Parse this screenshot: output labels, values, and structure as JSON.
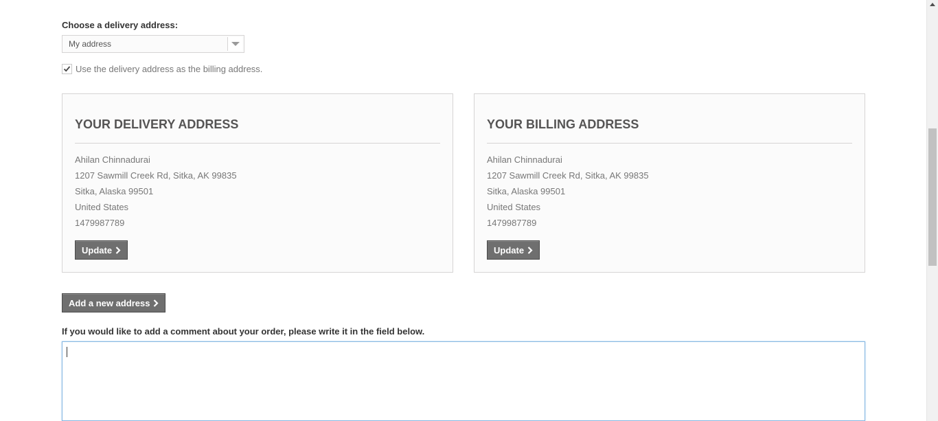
{
  "delivery_select": {
    "label": "Choose a delivery address:",
    "selected": "My address"
  },
  "billing_checkbox": {
    "checked": true,
    "label": "Use the delivery address as the billing address."
  },
  "delivery_address": {
    "title": "Your delivery address",
    "name": "Ahilan Chinnadurai",
    "street": "1207 Sawmill Creek Rd, Sitka, AK 99835",
    "city_state_zip": "Sitka, Alaska 99501",
    "country": "United States",
    "phone": "1479987789",
    "update_label": "Update"
  },
  "billing_address": {
    "title": "Your billing address",
    "name": "Ahilan Chinnadurai",
    "street": "1207 Sawmill Creek Rd, Sitka, AK 99835",
    "city_state_zip": "Sitka, Alaska 99501",
    "country": "United States",
    "phone": "1479987789",
    "update_label": "Update"
  },
  "add_address_label": "Add a new address",
  "comment": {
    "label": "If you would like to add a comment about your order, please write it in the field below.",
    "value": ""
  },
  "colors": {
    "button_bg": "#6f6f6f",
    "box_bg": "#fbfbfb",
    "border": "#d6d4d4",
    "focus_border": "#86b7e1"
  }
}
